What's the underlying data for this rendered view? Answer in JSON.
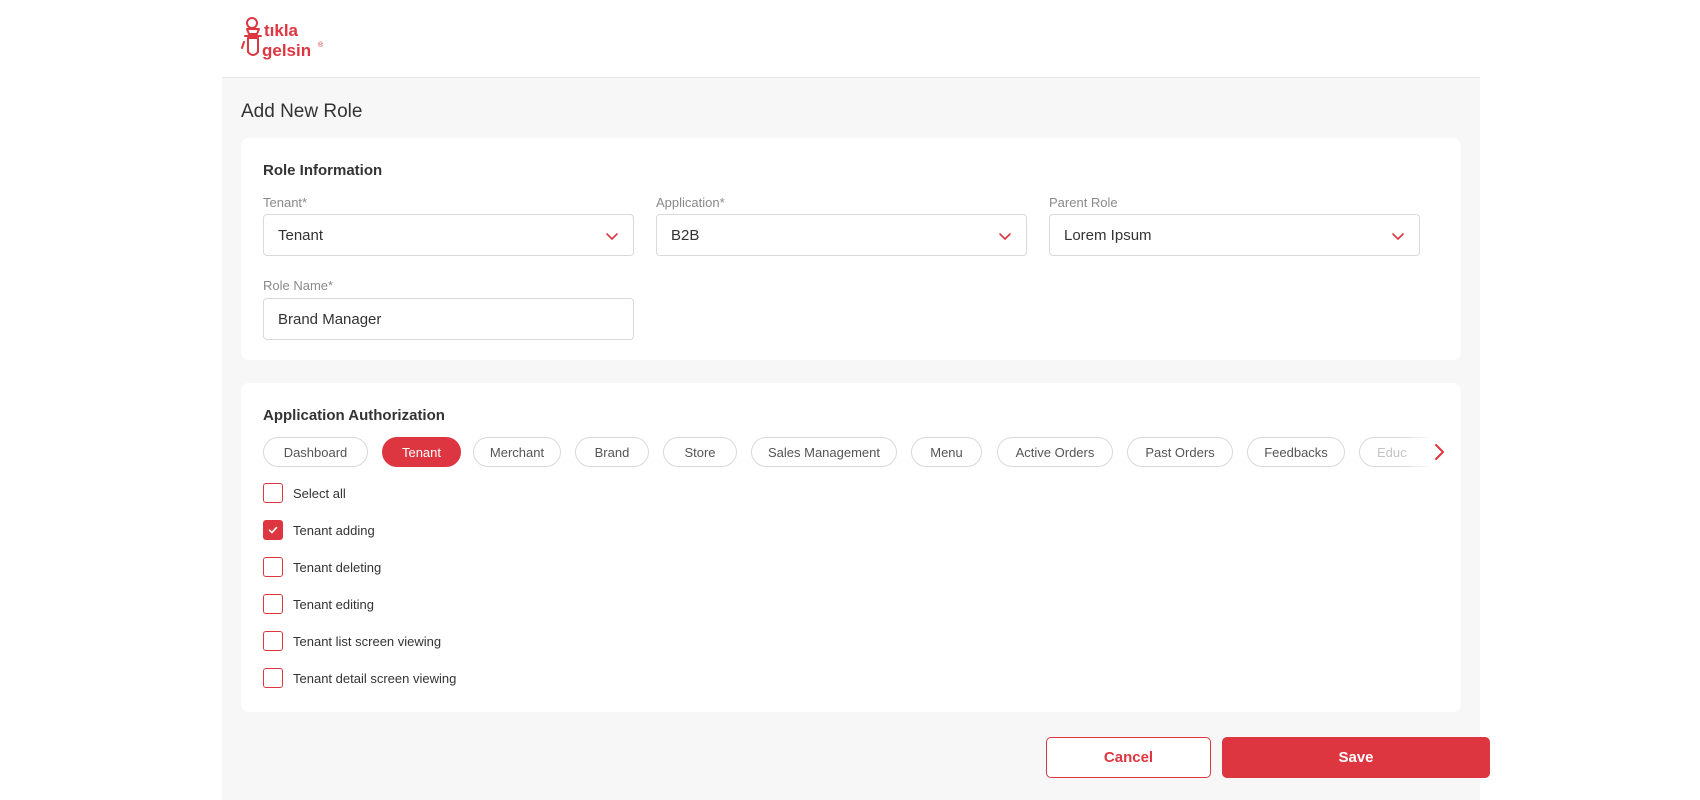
{
  "brand": {
    "logo_line1": "tıkla",
    "logo_line2": "gelsin",
    "logo_mark": "®",
    "accent_color": "#dd3640"
  },
  "page_title": "Add New Role",
  "role_information": {
    "title": "Role Information",
    "tenant": {
      "label": "Tenant*",
      "value": "Tenant"
    },
    "application": {
      "label": "Application*",
      "value": "B2B"
    },
    "parent_role": {
      "label": "Parent Role",
      "value": "Lorem Ipsum"
    },
    "role_name": {
      "label": "Role Name*",
      "value": "Brand Manager"
    }
  },
  "application_authorization": {
    "title": "Application Authorization",
    "tabs": [
      {
        "label": "Dashboard",
        "active": false
      },
      {
        "label": "Tenant",
        "active": true
      },
      {
        "label": "Merchant",
        "active": false
      },
      {
        "label": "Brand",
        "active": false
      },
      {
        "label": "Store",
        "active": false
      },
      {
        "label": "Sales Management",
        "active": false
      },
      {
        "label": "Menu",
        "active": false
      },
      {
        "label": "Active Orders",
        "active": false
      },
      {
        "label": "Past Orders",
        "active": false
      },
      {
        "label": "Feedbacks",
        "active": false
      },
      {
        "label": "Educ",
        "active": false
      }
    ],
    "permissions": [
      {
        "label": "Select all",
        "checked": false
      },
      {
        "label": "Tenant adding",
        "checked": true
      },
      {
        "label": "Tenant deleting",
        "checked": false
      },
      {
        "label": "Tenant editing",
        "checked": false
      },
      {
        "label": "Tenant list screen viewing",
        "checked": false
      },
      {
        "label": "Tenant detail screen viewing",
        "checked": false
      }
    ]
  },
  "actions": {
    "cancel_label": "Cancel",
    "save_label": "Save"
  },
  "icons": {
    "dropdown": "chevron-down-icon",
    "next": "chevron-right-icon",
    "check": "check-icon"
  }
}
